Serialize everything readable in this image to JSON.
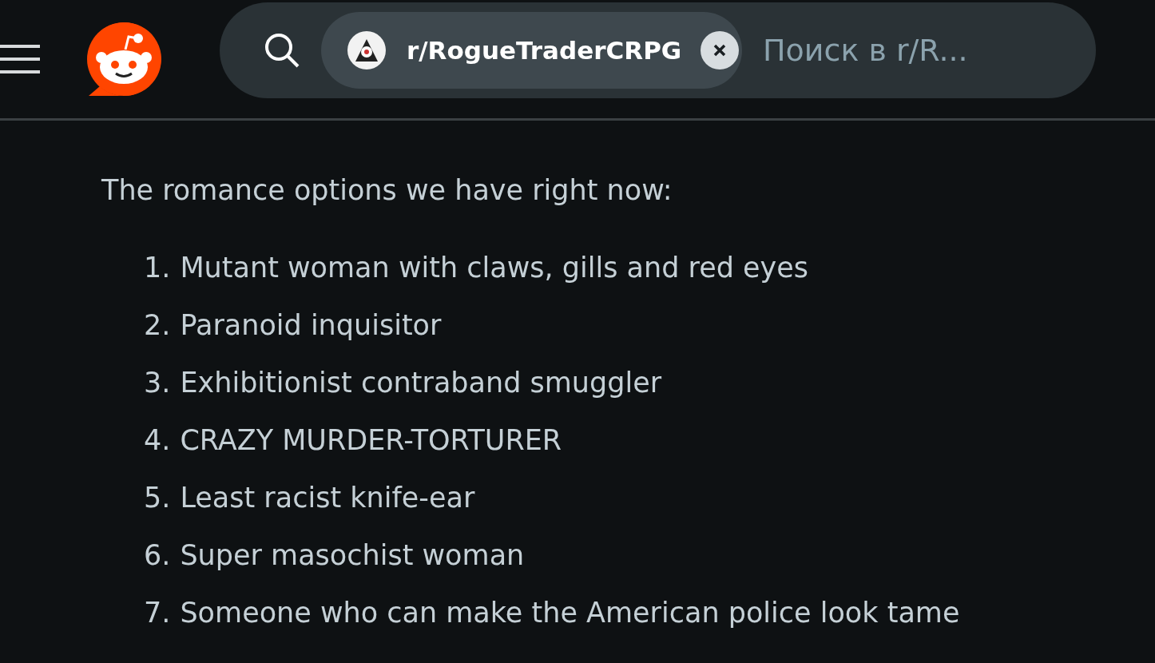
{
  "header": {
    "search": {
      "community_chip": {
        "label": "r/RogueTraderCRPG"
      },
      "placeholder": "Поиск в r/R..."
    }
  },
  "post": {
    "intro": "The romance options we have right now:",
    "list": [
      {
        "number": "1.",
        "text": "Mutant woman with claws, gills and red eyes"
      },
      {
        "number": "2.",
        "text": "Paranoid inquisitor"
      },
      {
        "number": "3.",
        "text": "Exhibitionist contraband smuggler"
      },
      {
        "number": "4.",
        "text": "CRAZY MURDER-TORTURER"
      },
      {
        "number": "5.",
        "text": "Least racist knife-ear"
      },
      {
        "number": "6.",
        "text": "Super masochist woman"
      },
      {
        "number": "7.",
        "text": "Someone who can make the American police look tame"
      }
    ]
  }
}
